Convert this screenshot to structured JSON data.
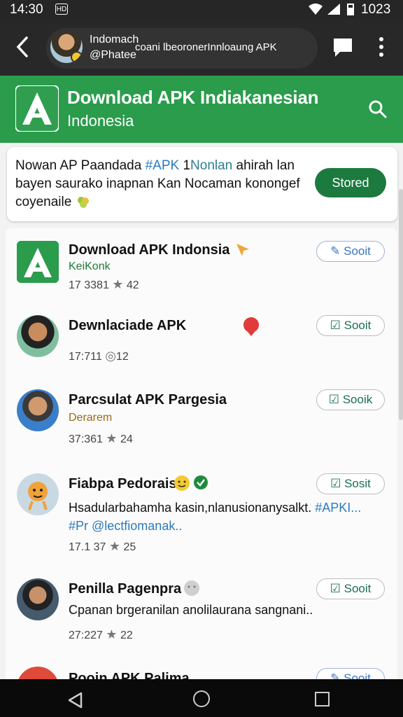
{
  "status": {
    "time": "14:30",
    "notif_label": "HD",
    "clock_right": "1023"
  },
  "topbar": {
    "name": "Indomach",
    "handle": "@Phatee",
    "subtitle": "coani lbeoronerInnloaung APK"
  },
  "header": {
    "title": "Download APK Indiakanesian",
    "subtitle": "Indonesia"
  },
  "announcement": {
    "text_a": "Nowan AP  Paandada ",
    "tag": "#APK",
    "text_b": " 1",
    "muted": "Nonlan",
    "text_c": " ahirah lan bayen saurako inapnan Kan Nocaman konongef coyenaile",
    "button": "Stored"
  },
  "items": [
    {
      "title": "Download APK Indonsia",
      "dev": "KeiKonk",
      "meta_a": "17 3381",
      "meta_b": "42",
      "button": "Sooit",
      "color_dev": "#1f7a3a"
    },
    {
      "title": "Dewnlaciade APK",
      "meta_a": "17:711",
      "meta_b": "12",
      "button": "Sooit"
    },
    {
      "title": "Parcsulat APK Pargesia",
      "dev": "Derarem",
      "meta_a": "37:361",
      "meta_b": "24",
      "button": "Sooik",
      "color_dev": "#9a6a1a"
    },
    {
      "title": "Fiabpa Pedorais",
      "desc_a": "Hsadularbahamha kasin,nlanusionanysalkt. ",
      "desc_tag": "#APKI...",
      "desc_b": "#Pr @lectfiomanak..",
      "meta_a": "17.1 37",
      "meta_b": "25",
      "button": "Sosit"
    },
    {
      "title": "Penilla Pagenpra",
      "desc_a": "Cpanan brgeranilan anolilaurana sangnani..",
      "meta_a": "27:227",
      "meta_b": "22",
      "button": "Sooit"
    },
    {
      "title": "Pooin APK Palima",
      "button": "Sooit"
    }
  ]
}
